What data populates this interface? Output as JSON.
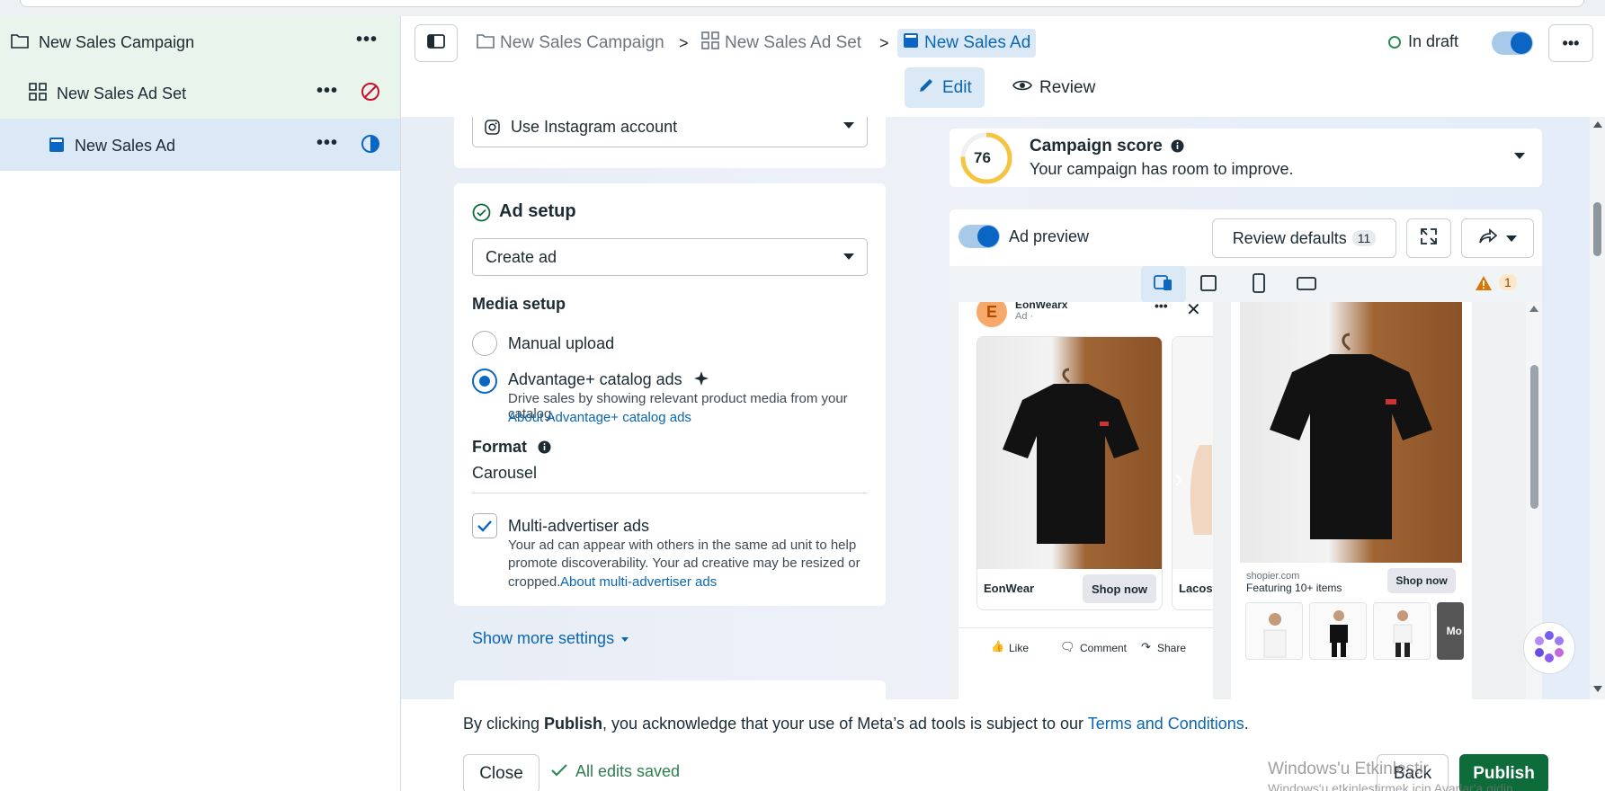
{
  "sidebar": {
    "campaign": {
      "label": "New Sales Campaign"
    },
    "adset": {
      "label": "New Sales Ad Set"
    },
    "ad": {
      "label": "New Sales Ad"
    },
    "more": "•••"
  },
  "header": {
    "breadcrumb": {
      "campaign": "New Sales Campaign",
      "adset": "New Sales Ad Set",
      "ad": "New Sales Ad",
      "separator": ">"
    },
    "status": "In draft",
    "more": "•••",
    "tabs": {
      "edit": "Edit",
      "review": "Review"
    }
  },
  "left_panel": {
    "instagram_select": "Use Instagram account",
    "ad_setup": {
      "title": "Ad setup",
      "create_select": "Create ad",
      "media_setup_title": "Media setup",
      "manual_upload": "Manual upload",
      "advantage_label": "Advantage+ catalog ads",
      "advantage_desc": "Drive sales by showing relevant product media from your catalog.",
      "advantage_link": "About Advantage+ catalog ads",
      "format_title": "Format",
      "format_value": "Carousel",
      "multi_label": "Multi-advertiser ads",
      "multi_desc_1": "Your ad can appear with others in the same ad unit to help",
      "multi_desc_2": "promote discoverability. Your ad creative may be resized or",
      "multi_desc_3": "cropped.",
      "multi_link": "About multi-advertiser ads",
      "show_more": "Show more settings"
    }
  },
  "right_panel": {
    "score": {
      "value": "76",
      "title": "Campaign score",
      "subtitle": "Your campaign has room to improve."
    },
    "preview": {
      "label": "Ad preview",
      "review_defaults": "Review defaults",
      "review_count": "11",
      "warning_count": "1",
      "feed": {
        "brand_initial": "E",
        "brand": "EonWearx",
        "ad_label": "Ad ·",
        "card1_name": "EonWear",
        "card1_cta": "Shop now",
        "card2_name": "Lacoste",
        "like": "Like",
        "comment": "Comment",
        "share": "Share"
      },
      "story": {
        "domain": "shopier.com",
        "featuring": "Featuring 10+ items",
        "cta": "Shop now",
        "thumb_more": "Mo"
      }
    }
  },
  "footer": {
    "notice_pre": "By clicking ",
    "notice_bold": "Publish",
    "notice_mid": ", you acknowledge that your use of Meta’s ad tools is subject to our ",
    "notice_link": "Terms and Conditions",
    "notice_end": ".",
    "close": "Close",
    "saved": "All edits saved",
    "back": "Back",
    "publish": "Publish",
    "watermark_1": "Windows'u Etkinleştir",
    "watermark_2": "Windows'u etkinleştirmek için Ayarlar'a gidin."
  },
  "colors": {
    "accent": "#0a66c2",
    "publish": "#0e6b3a",
    "campaign_bg": "#e8f4ec",
    "ad_bg": "#dbe9f6",
    "score_ring": "#f5c542",
    "warning": "#d97706"
  }
}
